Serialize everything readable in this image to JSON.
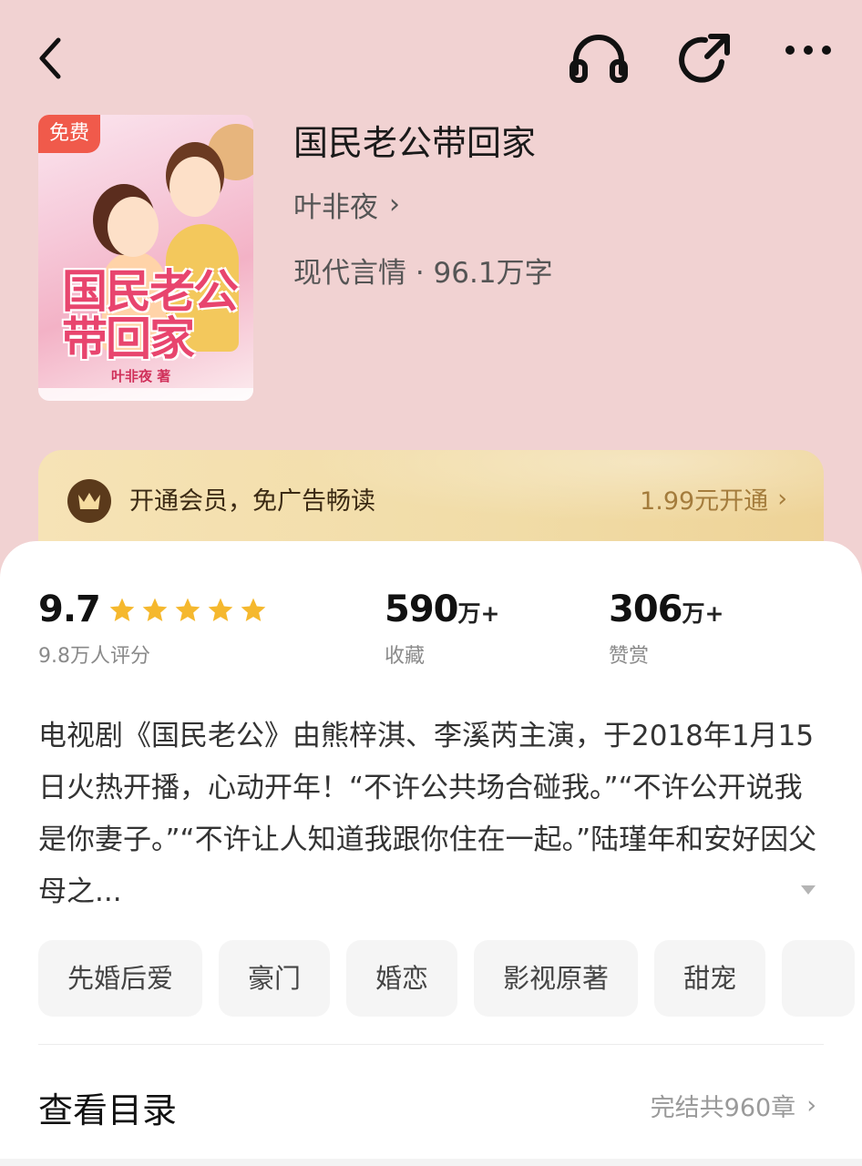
{
  "colors": {
    "page_bg": "#f1d2d2",
    "card_bg": "#ffffff",
    "star": "#f5b82e",
    "vip_gold": "#f1dca7",
    "vip_price": "#a47c3c",
    "badge": "#f05a4b"
  },
  "topbar": {
    "icons": [
      "back-icon",
      "headphones-icon",
      "share-icon",
      "more-icon"
    ]
  },
  "book": {
    "cover_badge": "免费",
    "cover_title_art": "国民老公带回家",
    "cover_author_art": "叶非夜 著",
    "title": "国民老公带回家",
    "author": "叶非夜",
    "author_chevron": "›",
    "meta": "现代言情 · 96.1万字"
  },
  "vip": {
    "text": "开通会员，免广告畅读",
    "price": "1.99元开通",
    "chevron": "›"
  },
  "stats": {
    "rating": {
      "value": "9.7",
      "stars": 5,
      "label": "9.8万人评分"
    },
    "collect": {
      "value": "590",
      "unit": "万+",
      "label": "收藏"
    },
    "reward": {
      "value": "306",
      "unit": "万+",
      "label": "赞赏"
    }
  },
  "description": "电视剧《国民老公》由熊梓淇、李溪芮主演，于2018年1月15日火热开播，心动开年！“不许公共场合碰我。”“不许公开说我是你妻子。”“不许让人知道我跟你住在一起。”陆瑾年和安好因父母之...",
  "tags": [
    "先婚后爱",
    "豪门",
    "婚恋",
    "影视原著",
    "甜宠"
  ],
  "catalog": {
    "title": "查看目录",
    "info": "完结共960章",
    "chevron": "›"
  }
}
